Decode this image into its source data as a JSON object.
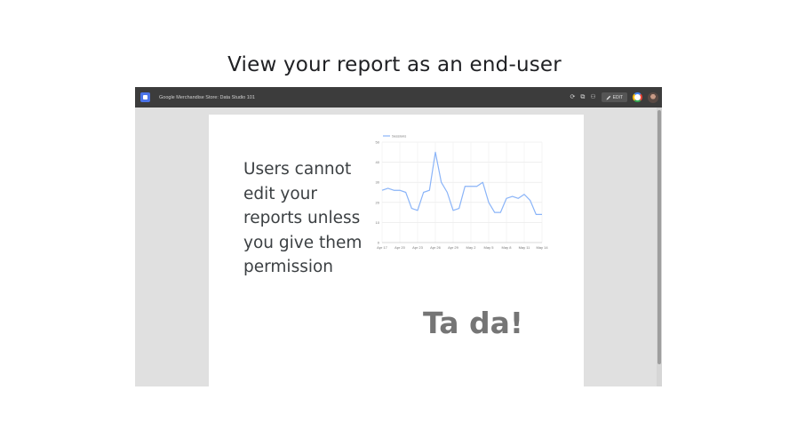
{
  "slide": {
    "title": "View your report as an end-user"
  },
  "app": {
    "report_title": "Google Merchandise Store: Data Studio 101",
    "toolbar": {
      "refresh_icon": "refresh-icon",
      "copy_icon": "copy-icon",
      "share_icon": "share-person-icon",
      "edit_label": "EDIT"
    },
    "colors": {
      "topbar": "#3c3c3c",
      "workspace": "#e0e0e0",
      "line": "#8ab4f8",
      "logo": "#4a73e8"
    }
  },
  "report": {
    "message": "Users cannot edit your reports unless you give them permission",
    "tada": "Ta da!"
  },
  "chart_data": {
    "type": "line",
    "legend_position": "top-left",
    "series": [
      {
        "name": "Sessions",
        "values": [
          26,
          27,
          26,
          26,
          25,
          17,
          16,
          25,
          26,
          45,
          30,
          25,
          16,
          17,
          28,
          28,
          28,
          30,
          20,
          15,
          15,
          22,
          23,
          22,
          24,
          21,
          14,
          14
        ]
      }
    ],
    "x_tick_labels": [
      "Apr 17",
      "Apr 20",
      "Apr 23",
      "Apr 26",
      "Apr 29",
      "May 2",
      "May 5",
      "May 8",
      "May 11",
      "May 14"
    ],
    "y_ticks": [
      50,
      40,
      30,
      20,
      10,
      0
    ],
    "ylim": [
      0,
      50
    ],
    "grid": true
  }
}
